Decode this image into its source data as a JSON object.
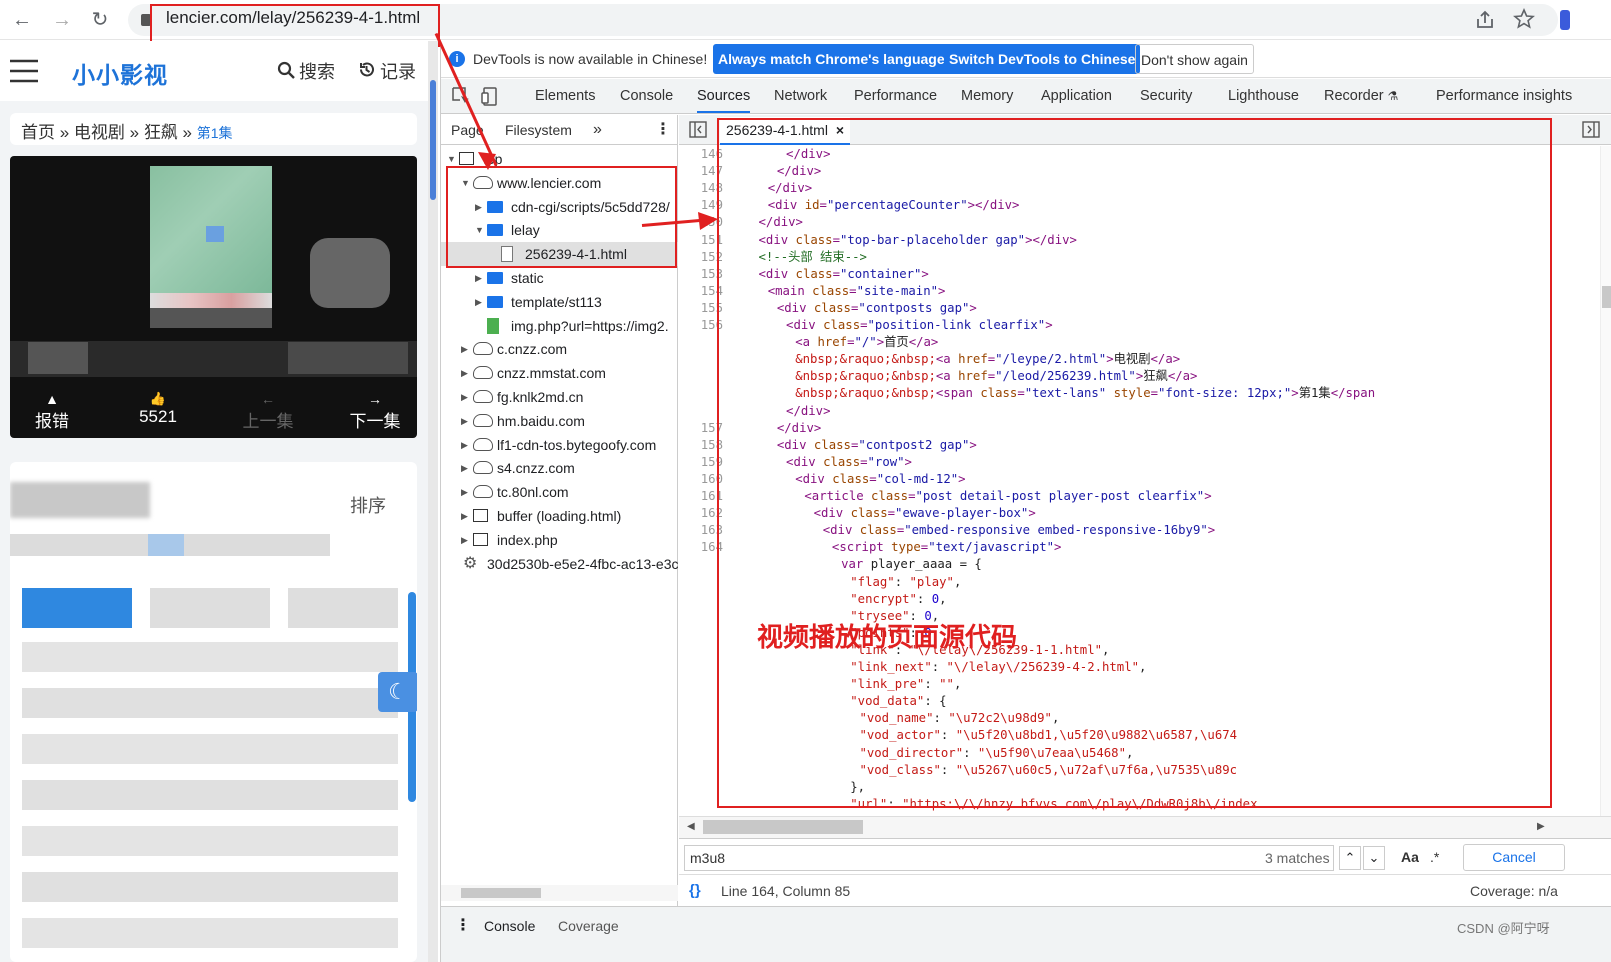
{
  "browser": {
    "url": "lencier.com/lelay/256239-4-1.html",
    "back_icon": "←",
    "forward_icon": "→",
    "reload_icon": "↻"
  },
  "site": {
    "logo": "小小影视",
    "search_label": "搜索",
    "history_label": "记录",
    "breadcrumb": {
      "home": "首页",
      "sep1": " » ",
      "category": "电视剧",
      "sep2": " » ",
      "title": "狂飙",
      "sep3": " » ",
      "episode": "第1集"
    },
    "player_controls": {
      "report": "报错",
      "likes": "5521",
      "prev": "上一集",
      "next": "下一集"
    },
    "sort_label_partial": "排序"
  },
  "devtools": {
    "infobar": {
      "message": "DevTools is now available in Chinese!",
      "btn_match": "Always match Chrome's language",
      "btn_switch": "Switch DevTools to Chinese",
      "btn_dismiss": "Don't show again"
    },
    "tabs": [
      "Elements",
      "Console",
      "Sources",
      "Network",
      "Performance",
      "Memory",
      "Application",
      "Security",
      "Lighthouse",
      "Recorder",
      "Performance insights"
    ],
    "active_tab": "Sources",
    "navigator": {
      "tabs": [
        "Page",
        "Filesystem"
      ],
      "tree": [
        {
          "label": "top",
          "depth": 0,
          "icon": "frame",
          "open": true
        },
        {
          "label": "www.lencier.com",
          "depth": 1,
          "icon": "cloud",
          "open": true
        },
        {
          "label": "cdn-cgi/scripts/5c5dd728/",
          "depth": 2,
          "icon": "folder",
          "open": false
        },
        {
          "label": "lelay",
          "depth": 2,
          "icon": "folder",
          "open": true
        },
        {
          "label": "256239-4-1.html",
          "depth": 3,
          "icon": "file",
          "selected": true
        },
        {
          "label": "static",
          "depth": 2,
          "icon": "folder",
          "open": false
        },
        {
          "label": "template/st113",
          "depth": 2,
          "icon": "folder",
          "open": false
        },
        {
          "label": "img.php?url=https://img2.",
          "depth": 2,
          "icon": "file-green"
        },
        {
          "label": "c.cnzz.com",
          "depth": 1,
          "icon": "cloud",
          "open": false
        },
        {
          "label": "cnzz.mmstat.com",
          "depth": 1,
          "icon": "cloud",
          "open": false
        },
        {
          "label": "fg.knlk2md.cn",
          "depth": 1,
          "icon": "cloud",
          "open": false
        },
        {
          "label": "hm.baidu.com",
          "depth": 1,
          "icon": "cloud",
          "open": false
        },
        {
          "label": "lf1-cdn-tos.bytegoofy.com",
          "depth": 1,
          "icon": "cloud",
          "open": false
        },
        {
          "label": "s4.cnzz.com",
          "depth": 1,
          "icon": "cloud",
          "open": false
        },
        {
          "label": "tc.80nl.com",
          "depth": 1,
          "icon": "cloud",
          "open": false
        },
        {
          "label": "buffer (loading.html)",
          "depth": 1,
          "icon": "frame",
          "open": false
        },
        {
          "label": "index.php",
          "depth": 1,
          "icon": "frame",
          "open": false
        },
        {
          "label": "30d2530b-e5e2-4fbc-ac13-e3c",
          "depth": 0,
          "icon": "gear"
        }
      ]
    },
    "editor": {
      "file_tab": "256239-4-1.html",
      "lines": [
        {
          "n": "146",
          "ind": 12,
          "html": "<span class='t'>&lt;/div&gt;</span>"
        },
        {
          "n": "147",
          "ind": 10,
          "html": "<span class='t'>&lt;/div&gt;</span>"
        },
        {
          "n": "148",
          "ind": 8,
          "html": "<span class='t'>&lt;/div&gt;</span>"
        },
        {
          "n": "149",
          "ind": 8,
          "html": "<span class='t'>&lt;div </span><span class='a'>id</span><span class='t'>=</span><span class='v'>\"percentageCounter\"</span><span class='t'>&gt;&lt;/div&gt;</span>"
        },
        {
          "n": "150",
          "ind": 6,
          "html": "<span class='t'>&lt;/div&gt;</span>"
        },
        {
          "n": "151",
          "ind": 6,
          "html": "<span class='t'>&lt;div </span><span class='a'>class</span><span class='t'>=</span><span class='v'>\"top-bar-placeholder gap\"</span><span class='t'>&gt;&lt;/div&gt;</span>"
        },
        {
          "n": "152",
          "ind": 6,
          "html": "<span class='c'>&lt;!--头部 结束--&gt;</span>"
        },
        {
          "n": "153",
          "ind": 6,
          "html": "<span class='t'>&lt;div </span><span class='a'>class</span><span class='t'>=</span><span class='v'>\"container\"</span><span class='t'>&gt;</span>"
        },
        {
          "n": "154",
          "ind": 8,
          "html": "<span class='t'>&lt;main </span><span class='a'>class</span><span class='t'>=</span><span class='v'>\"site-main\"</span><span class='t'>&gt;</span>"
        },
        {
          "n": "155",
          "ind": 10,
          "html": "<span class='t'>&lt;div </span><span class='a'>class</span><span class='t'>=</span><span class='v'>\"contposts gap\"</span><span class='t'>&gt;</span>"
        },
        {
          "n": "156",
          "ind": 12,
          "html": "<span class='t'>&lt;div </span><span class='a'>class</span><span class='t'>=</span><span class='v'>\"position-link clearfix\"</span><span class='t'>&gt;</span>"
        },
        {
          "n": "",
          "ind": 14,
          "html": "<span class='t'>&lt;a </span><span class='a'>href</span><span class='t'>=</span><span class='v'>\"/\"</span><span class='t'>&gt;</span>首页<span class='t'>&lt;/a&gt;</span>"
        },
        {
          "n": "",
          "ind": 14,
          "html": "<span class='s'>&amp;nbsp;&amp;raquo;&amp;nbsp;</span><span class='t'>&lt;a </span><span class='a'>href</span><span class='t'>=</span><span class='v'>\"/leype/2.html\"</span><span class='t'>&gt;</span>电视剧<span class='t'>&lt;/a&gt;</span>"
        },
        {
          "n": "",
          "ind": 14,
          "html": "<span class='s'>&amp;nbsp;&amp;raquo;&amp;nbsp;</span><span class='t'>&lt;a </span><span class='a'>href</span><span class='t'>=</span><span class='v'>\"/leod/256239.html\"</span><span class='t'>&gt;</span>狂飙<span class='t'>&lt;/a&gt;</span>"
        },
        {
          "n": "",
          "ind": 14,
          "html": "<span class='s'>&amp;nbsp;&amp;raquo;&amp;nbsp;</span><span class='t'>&lt;span </span><span class='a'>class</span><span class='t'>=</span><span class='v'>\"text-lans\"</span><span class='a'> style</span><span class='t'>=</span><span class='v'>\"font-size: 12px;\"</span><span class='t'>&gt;</span>第1集<span class='t'>&lt;/span</span>"
        },
        {
          "n": "",
          "ind": 12,
          "html": "<span class='t'>&lt;/div&gt;</span>"
        },
        {
          "n": "157",
          "ind": 10,
          "html": "<span class='t'>&lt;/div&gt;</span>"
        },
        {
          "n": "158",
          "ind": 10,
          "html": "<span class='t'>&lt;div </span><span class='a'>class</span><span class='t'>=</span><span class='v'>\"contpost2 gap\"</span><span class='t'>&gt;</span>"
        },
        {
          "n": "159",
          "ind": 12,
          "html": "<span class='t'>&lt;div </span><span class='a'>class</span><span class='t'>=</span><span class='v'>\"row\"</span><span class='t'>&gt;</span>"
        },
        {
          "n": "160",
          "ind": 14,
          "html": "<span class='t'>&lt;div </span><span class='a'>class</span><span class='t'>=</span><span class='v'>\"col-md-12\"</span><span class='t'>&gt;</span>"
        },
        {
          "n": "161",
          "ind": 16,
          "html": "<span class='t'>&lt;article </span><span class='a'>class</span><span class='t'>=</span><span class='v'>\"post detail-post player-post clearfix\"</span><span class='t'>&gt;</span>"
        },
        {
          "n": "162",
          "ind": 18,
          "html": "<span class='t'>&lt;div </span><span class='a'>class</span><span class='t'>=</span><span class='v'>\"ewave-player-box\"</span><span class='t'>&gt;</span>"
        },
        {
          "n": "163",
          "ind": 20,
          "html": "<span class='t'>&lt;div </span><span class='a'>class</span><span class='t'>=</span><span class='v'>\"embed-responsive embed-responsive-16by9\"</span><span class='t'>&gt;</span>"
        },
        {
          "n": "164",
          "ind": 22,
          "html": "<span class='t'>&lt;script </span><span class='a'>type</span><span class='t'>=</span><span class='v'>\"text/javascript\"</span><span class='t'>&gt;</span>"
        },
        {
          "n": "",
          "ind": 24,
          "html": "<span class='t'>var</span> player_aaaa = {"
        },
        {
          "n": "",
          "ind": 26,
          "html": "<span class='s'>\"flag\"</span>: <span class='s'>\"play\"</span>,"
        },
        {
          "n": "",
          "ind": 26,
          "html": "<span class='s'>\"encrypt\"</span>: <span class='n'>0</span>,"
        },
        {
          "n": "",
          "ind": 26,
          "html": "<span class='s'>\"trysee\"</span>: <span class='n'>0</span>,"
        },
        {
          "n": "",
          "ind": 26,
          "html": "<span class='s'>\"points\"</span>: <span class='n'>0</span>,"
        },
        {
          "n": "",
          "ind": 26,
          "html": "<span class='s'>\"link\"</span>: <span class='s'>\"\\/lelay\\/256239-1-1.html\"</span>,"
        },
        {
          "n": "",
          "ind": 26,
          "html": "<span class='s'>\"link_next\"</span>: <span class='s'>\"\\/lelay\\/256239-4-2.html\"</span>,"
        },
        {
          "n": "",
          "ind": 26,
          "html": "<span class='s'>\"link_pre\"</span>: <span class='s'>\"\"</span>,"
        },
        {
          "n": "",
          "ind": 26,
          "html": "<span class='s'>\"vod_data\"</span>: {"
        },
        {
          "n": "",
          "ind": 28,
          "html": "<span class='s'>\"vod_name\"</span>: <span class='s'>\"\\u72c2\\u98d9\"</span>,"
        },
        {
          "n": "",
          "ind": 28,
          "html": "<span class='s'>\"vod_actor\"</span>: <span class='s'>\"\\u5f20\\u8bd1,\\u5f20\\u9882\\u6587,\\u674</span>"
        },
        {
          "n": "",
          "ind": 28,
          "html": "<span class='s'>\"vod_director\"</span>: <span class='s'>\"\\u5f90\\u7eaa\\u5468\"</span>,"
        },
        {
          "n": "",
          "ind": 28,
          "html": "<span class='s'>\"vod_class\"</span>: <span class='s'>\"\\u5267\\u60c5,\\u72af\\u7f6a,\\u7535\\u89c</span>"
        },
        {
          "n": "",
          "ind": 26,
          "html": "},"
        },
        {
          "n": "",
          "ind": 26,
          "html": "<span class='s'>\"url\"</span>: <span class='s'>\"https:\\/\\/hnzy.bfvvs.com\\/play\\/DdwR0j8b\\/index</span>"
        }
      ]
    },
    "annotation": "视频播放的页面源代码",
    "search": {
      "query": "m3u8",
      "matches": "3 matches",
      "cancel": "Cancel",
      "case_label": "Aa",
      "regex_label": ".*"
    },
    "status": {
      "position": "Line 164, Column 85",
      "coverage": "Coverage: n/a",
      "braces": "{}"
    },
    "drawer_tabs": [
      "Console",
      "Coverage"
    ],
    "watermark": "CSDN @阿宁呀"
  },
  "colors": {
    "accent": "#1a73e8",
    "annotation_red": "#e02020",
    "logo_blue": "#1e73d8"
  }
}
